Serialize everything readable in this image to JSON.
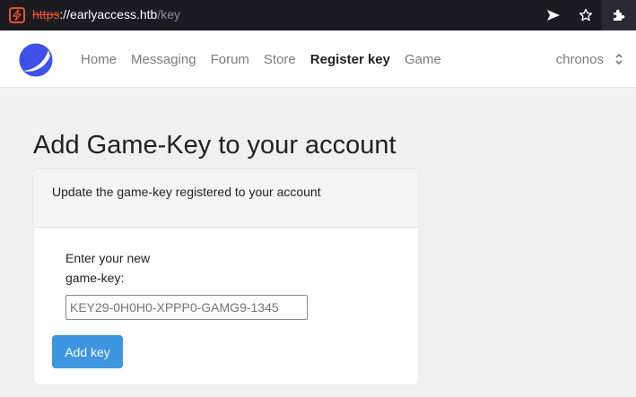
{
  "browser": {
    "url_scheme": "https",
    "url_separator": "://",
    "url_host": "earlyaccess.htb",
    "url_path": "/key",
    "icons": [
      "site-security-icon",
      "send-icon",
      "star-icon",
      "extension-icon"
    ],
    "accent_color": "#e8542f"
  },
  "nav": {
    "links": [
      {
        "label": "Home",
        "active": false
      },
      {
        "label": "Messaging",
        "active": false
      },
      {
        "label": "Forum",
        "active": false
      },
      {
        "label": "Store",
        "active": false
      },
      {
        "label": "Register key",
        "active": true
      },
      {
        "label": "Game",
        "active": false
      }
    ],
    "user": "chronos"
  },
  "main": {
    "title": "Add Game-Key to your account",
    "card_header": "Update the game-key registered to your account",
    "field_label": "Enter your new game-key:",
    "input_placeholder": "KEY29-0H0H0-XPPP0-GAMG9-1345",
    "input_value": "",
    "button_label": "Add key",
    "button_color": "#3d96df"
  }
}
